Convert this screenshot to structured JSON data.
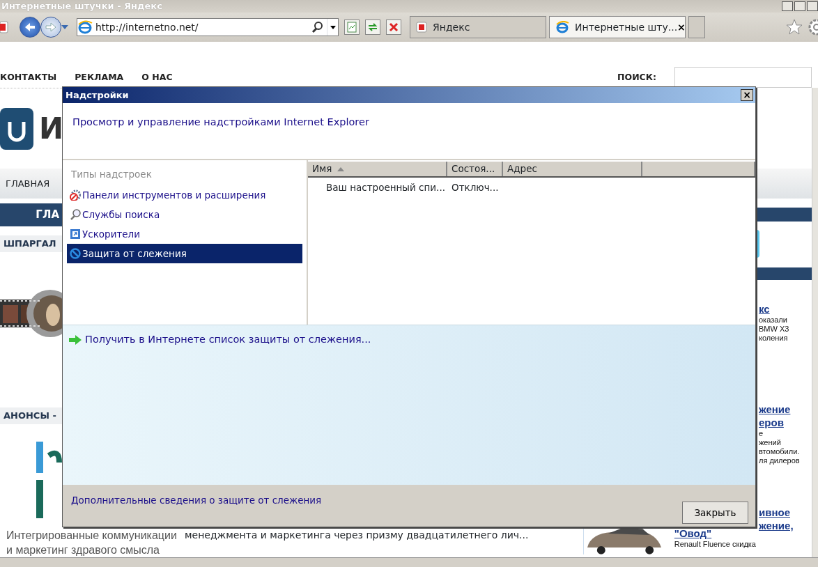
{
  "window": {
    "title": "Интернетные штучки - Яндекс"
  },
  "toolbar": {
    "address": "http://internetno.net/"
  },
  "tabs": [
    {
      "label": "Яндекс",
      "selected": false
    },
    {
      "label": "Интернетные шту...",
      "selected": true,
      "close": "×"
    }
  ],
  "page": {
    "nav": [
      "КОНТАКТЫ",
      "РЕКЛАМА",
      "О НАС"
    ],
    "search_label": "ПОИСК:",
    "logo_text": "И",
    "menu_item": "ГЛАВНАЯ",
    "banner": "ГЛА",
    "sections": [
      "ШПАРГАЛ",
      "АНОНСЫ -"
    ],
    "sponsor_lines": [
      "Интегрированные коммуникации",
      "и маркетинг здравого смысла"
    ],
    "excerpt": "менеджмента и маркетинга через призму двадцатилетнего лич...",
    "right_column": [
      {
        "kind": "title",
        "text": "кс"
      },
      {
        "kind": "text",
        "text": "оказали"
      },
      {
        "kind": "text",
        "text": "BMW X3"
      },
      {
        "kind": "text",
        "text": "коления"
      },
      {
        "kind": "title",
        "text": "жение"
      },
      {
        "kind": "title",
        "text": "еров"
      },
      {
        "kind": "text",
        "text": "е"
      },
      {
        "kind": "text",
        "text": "жений"
      },
      {
        "kind": "text",
        "text": "втомобили."
      },
      {
        "kind": "text",
        "text": "ля дилеров"
      },
      {
        "kind": "title",
        "text": "ивное"
      },
      {
        "kind": "title",
        "text": "жение,"
      }
    ],
    "bottom_news": {
      "title": "\"Овод\"",
      "text": "Renault Fluence скидка"
    }
  },
  "dialog": {
    "title": "Надстройки",
    "close": "×",
    "heading": "Просмотр и управление надстройками Internet Explorer",
    "types_label": "Типы надстроек",
    "types": [
      {
        "label": "Панели инструментов и расширения",
        "selected": false
      },
      {
        "label": "Службы поиска",
        "selected": false
      },
      {
        "label": "Ускорители",
        "selected": false
      },
      {
        "label": "Защита от слежения",
        "selected": true
      }
    ],
    "columns": [
      {
        "label": "Имя",
        "sorted_ascending": true
      },
      {
        "label": "Состоя..."
      },
      {
        "label": "Адрес"
      }
    ],
    "rows": [
      {
        "cells": [
          "Ваш настроенный спи...",
          "Отключ..."
        ]
      }
    ],
    "get_list_link": "Получить в Интернете список защиты от слежения...",
    "more_info_link": "Дополнительные сведения о защите от слежения",
    "close_button": "Закрыть"
  }
}
